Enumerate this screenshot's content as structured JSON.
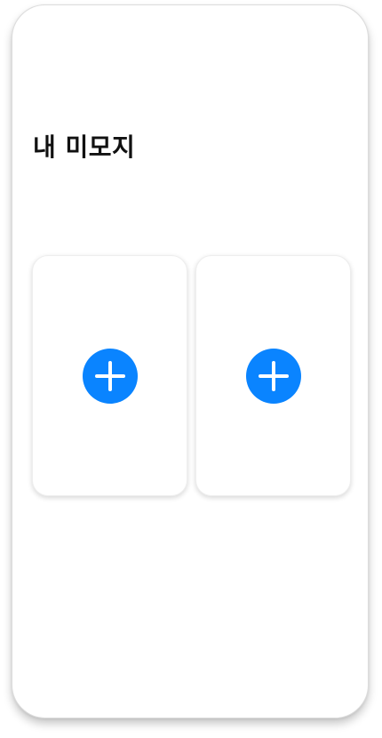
{
  "page": {
    "title": "내 미모지"
  },
  "slots": [
    {
      "action": "add",
      "icon": "plus-circle-icon"
    },
    {
      "action": "add",
      "icon": "plus-circle-icon"
    }
  ],
  "colors": {
    "accent": "#0A84FF",
    "title": "#111111",
    "background": "#FFFFFF"
  }
}
